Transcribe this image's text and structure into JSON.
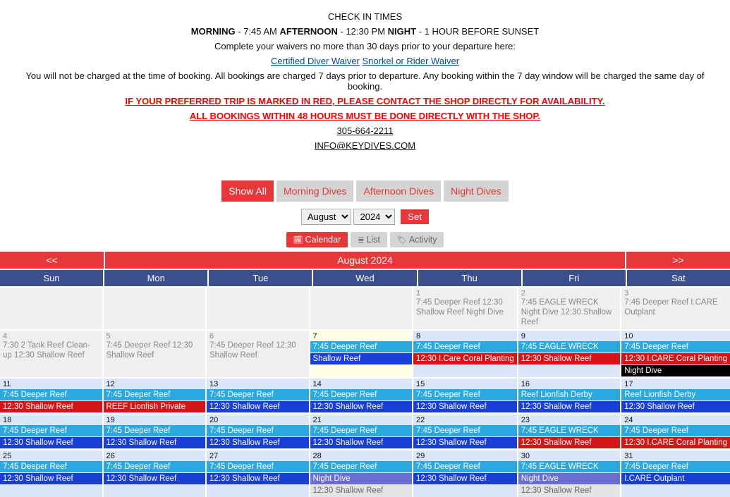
{
  "header": {
    "check_in_title": "CHECK IN TIMES",
    "morning_label": "MORNING",
    "morning_time": " - 7:45 AM  ",
    "afternoon_label": "AFTERNOON",
    "afternoon_time": " - 12:30 PM ",
    "night_label": "NIGHT",
    "night_time": " - 1 HOUR BEFORE SUNSET",
    "waiver_note": "Complete your waivers no more than 30 days prior to your departure here:",
    "waiver_link1": "Certified Diver Waiver",
    "waiver_link2": "Snorkel or Rider Waiver",
    "charge_note": "You will not be charged at the time of booking. All bookings are charged 7 days prior to departure. Any booking within the 7 day window will be charged the same day of booking.",
    "red_note1": "IF YOUR PREFERRED TRIP IS MARKED IN RED, PLEASE CONTACT THE SHOP DIRECTLY FOR AVAILABILITY.",
    "red_note2": "ALL BOOKINGS WITHIN 48 HOURS MUST BE DONE DIRECTLY WITH THE SHOP.",
    "phone": "305-664-2211",
    "email": "INFO@KEYDIVES.COM"
  },
  "filters": [
    "Show All",
    "Morning Dives",
    "Afternoon Dives",
    "Night Dives"
  ],
  "month_picker": {
    "month": "August",
    "year": "2024",
    "set": "Set"
  },
  "views": [
    "Calendar",
    "List",
    "Activity"
  ],
  "calendar": {
    "prev": "<<",
    "title": "August 2024",
    "next": ">>",
    "dow": [
      "Sun",
      "Mon",
      "Tue",
      "Wed",
      "Thu",
      "Fri",
      "Sat"
    ],
    "weeks": [
      [
        {
          "blank": true,
          "cls": "pale-past"
        },
        {
          "blank": true,
          "cls": "pale-past"
        },
        {
          "blank": true,
          "cls": "pale-past"
        },
        {
          "blank": true,
          "cls": "pale-past"
        },
        {
          "day": "1",
          "cls": "pale-past",
          "text": "7:45 Deeper Reef 12:30 Shallow Reef Night Dive"
        },
        {
          "day": "2",
          "cls": "pale-past",
          "text": "7:45 EAGLE WRECK Night Dive 12:30 Shallow Reef"
        },
        {
          "day": "3",
          "cls": "pale-past",
          "text": "7:45 Deeper Reef I.CARE Outplant"
        }
      ],
      [
        {
          "day": "4",
          "cls": "pale-past",
          "text": "7:30 2 Tank Reef Clean-up 12:30 Shallow Reef"
        },
        {
          "day": "5",
          "cls": "pale-past",
          "text": "7:45 Deeper Reef 12:30 Shallow Reef"
        },
        {
          "day": "6",
          "cls": "pale-past",
          "text": "7:45 Deeper Reef 12:30 Shallow Reef"
        },
        {
          "day": "7",
          "cls": "highlight-today",
          "events": [
            {
              "t": "7:45 Deeper Reef",
              "c": "ev-sky"
            },
            {
              "t": "Shallow Reef",
              "c": "ev-blue"
            }
          ]
        },
        {
          "day": "8",
          "cls": "pale-current",
          "events": [
            {
              "t": "7:45 Deeper Reef",
              "c": "ev-sky"
            },
            {
              "t": "12:30 I.Care Coral Planting",
              "c": "ev-red"
            }
          ]
        },
        {
          "day": "9",
          "cls": "pale-current",
          "events": [
            {
              "t": "7:45 EAGLE WRECK",
              "c": "ev-sky"
            },
            {
              "t": "12:30 Shallow Reef",
              "c": "ev-red"
            }
          ]
        },
        {
          "day": "10",
          "cls": "pale-current",
          "events": [
            {
              "t": "7:45 Deeper Reef",
              "c": "ev-sky"
            },
            {
              "t": "12:30 I.CARE Coral Planting",
              "c": "ev-red"
            },
            {
              "t": "Night Dive",
              "c": "ev-black"
            }
          ]
        }
      ],
      [
        {
          "day": "11",
          "cls": "pale-current",
          "events": [
            {
              "t": "7:45 Deeper Reef",
              "c": "ev-sky"
            },
            {
              "t": "12:30 Shallow Reef",
              "c": "ev-red"
            }
          ]
        },
        {
          "day": "12",
          "cls": "pale-current",
          "events": [
            {
              "t": "7:45 Deeper Reef",
              "c": "ev-sky"
            },
            {
              "t": "REEF Lionfish Private",
              "c": "ev-red"
            }
          ]
        },
        {
          "day": "13",
          "cls": "pale-current",
          "events": [
            {
              "t": "7:45 Deeper Reef",
              "c": "ev-sky"
            },
            {
              "t": "12:30 Shallow Reef",
              "c": "ev-blue"
            }
          ]
        },
        {
          "day": "14",
          "cls": "pale-current",
          "events": [
            {
              "t": "7:45 Deeper Reef",
              "c": "ev-sky"
            },
            {
              "t": "12:30 Shallow Reef",
              "c": "ev-blue"
            }
          ]
        },
        {
          "day": "15",
          "cls": "pale-current",
          "events": [
            {
              "t": "7:45 Deeper Reef",
              "c": "ev-sky"
            },
            {
              "t": "12:30 Shallow Reef",
              "c": "ev-blue"
            }
          ]
        },
        {
          "day": "16",
          "cls": "pale-current",
          "events": [
            {
              "t": "Reef Lionfish Derby",
              "c": "ev-sky"
            },
            {
              "t": "12:30 Shallow Reef",
              "c": "ev-blue"
            }
          ]
        },
        {
          "day": "17",
          "cls": "pale-current",
          "events": [
            {
              "t": "Reef Lionfish Derby",
              "c": "ev-sky"
            },
            {
              "t": "12:30 Shallow Reef",
              "c": "ev-blue"
            }
          ]
        }
      ],
      [
        {
          "day": "18",
          "cls": "pale-current",
          "events": [
            {
              "t": "7:45 Deeper Reef",
              "c": "ev-sky"
            },
            {
              "t": "12:30 Shallow Reef",
              "c": "ev-blue"
            }
          ]
        },
        {
          "day": "19",
          "cls": "pale-current",
          "events": [
            {
              "t": "7:45 Deeper Reef",
              "c": "ev-sky"
            },
            {
              "t": "12:30 Shallow Reef",
              "c": "ev-blue"
            }
          ]
        },
        {
          "day": "20",
          "cls": "pale-current",
          "events": [
            {
              "t": "7:45 Deeper Reef",
              "c": "ev-sky"
            },
            {
              "t": "12:30 Shallow Reef",
              "c": "ev-blue"
            }
          ]
        },
        {
          "day": "21",
          "cls": "pale-current",
          "events": [
            {
              "t": "7:45 Deeper Reef",
              "c": "ev-sky"
            },
            {
              "t": "12:30 Shallow Reef",
              "c": "ev-blue"
            }
          ]
        },
        {
          "day": "22",
          "cls": "pale-current",
          "events": [
            {
              "t": "7:45 Deeper Reef",
              "c": "ev-sky"
            },
            {
              "t": "12:30 Shallow Reef",
              "c": "ev-blue"
            }
          ]
        },
        {
          "day": "23",
          "cls": "pale-current",
          "events": [
            {
              "t": "7:45 EAGLE WRECK",
              "c": "ev-sky"
            },
            {
              "t": "12:30 Shallow Reef",
              "c": "ev-red"
            }
          ]
        },
        {
          "day": "24",
          "cls": "pale-current",
          "events": [
            {
              "t": "7:45 Deeper Reef",
              "c": "ev-sky"
            },
            {
              "t": "12:30 I.CARE Coral Planting",
              "c": "ev-red"
            }
          ]
        }
      ],
      [
        {
          "day": "25",
          "cls": "pale-current",
          "events": [
            {
              "t": "7:45 Deeper Reef",
              "c": "ev-sky"
            },
            {
              "t": "12:30 Shallow Reef",
              "c": "ev-blue"
            }
          ]
        },
        {
          "day": "26",
          "cls": "pale-current",
          "events": [
            {
              "t": "7:45 Deeper Reef",
              "c": "ev-sky"
            },
            {
              "t": "12:30 Shallow Reef",
              "c": "ev-blue"
            }
          ]
        },
        {
          "day": "27",
          "cls": "pale-current",
          "events": [
            {
              "t": "7:45 Deeper Reef",
              "c": "ev-sky"
            },
            {
              "t": "12:30 Shallow Reef",
              "c": "ev-blue"
            }
          ]
        },
        {
          "day": "28",
          "cls": "pale-current",
          "events": [
            {
              "t": "7:45 Deeper Reef",
              "c": "ev-sky"
            },
            {
              "t": "Night Dive",
              "c": "ev-purple"
            },
            {
              "t": "12:30 Shallow Reef",
              "c": "ev-grey"
            }
          ]
        },
        {
          "day": "29",
          "cls": "pale-current",
          "events": [
            {
              "t": "7:45 Deeper Reef",
              "c": "ev-sky"
            },
            {
              "t": "12:30 Shallow Reef",
              "c": "ev-blue"
            }
          ]
        },
        {
          "day": "30",
          "cls": "pale-current",
          "events": [
            {
              "t": "7:45 EAGLE WRECK",
              "c": "ev-sky"
            },
            {
              "t": "Night Dive",
              "c": "ev-purple"
            },
            {
              "t": "12:30 Shallow Reef",
              "c": "ev-grey"
            }
          ]
        },
        {
          "day": "31",
          "cls": "pale-current",
          "events": [
            {
              "t": "7:45 Deeper Reef",
              "c": "ev-sky"
            },
            {
              "t": "I.CARE Outplant",
              "c": "ev-blue"
            }
          ]
        }
      ]
    ]
  }
}
